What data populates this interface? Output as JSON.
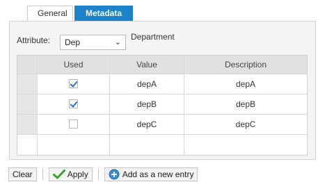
{
  "tabs": {
    "general": "General",
    "metadata": "Metadata"
  },
  "attribute": {
    "label": "Attribute:",
    "selected": "Dep",
    "description": "Department"
  },
  "table": {
    "columns": [
      "Used",
      "Value",
      "Description"
    ],
    "rows": [
      {
        "used": true,
        "value": "depA",
        "description": "depA"
      },
      {
        "used": true,
        "value": "depB",
        "description": "depB"
      },
      {
        "used": false,
        "value": "depC",
        "description": "depC"
      }
    ]
  },
  "toolbar": {
    "clear": "Clear",
    "apply": "Apply",
    "add_new": "Add as a new entry"
  },
  "colors": {
    "accent": "#1c82c9",
    "check": "#3aa02e"
  }
}
